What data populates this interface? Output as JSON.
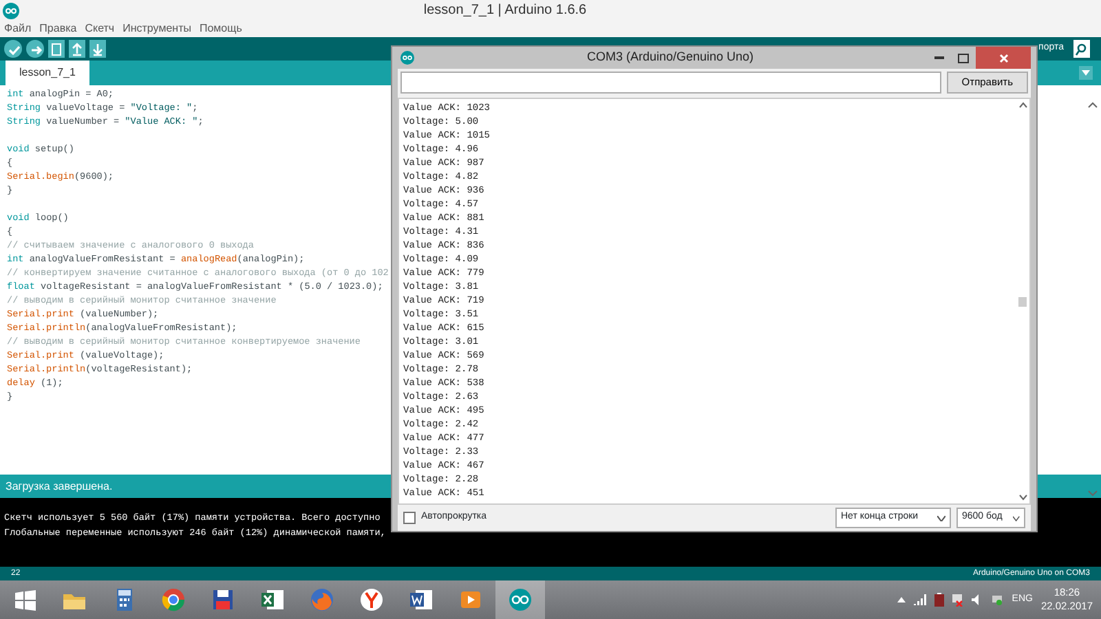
{
  "ide_window": {
    "title": "lesson_7_1 | Arduino 1.6.6",
    "menu": [
      "Файл",
      "Правка",
      "Скетч",
      "Инструменты",
      "Помощь"
    ],
    "toolbar": {
      "buttons": [
        {
          "kind": "verify"
        },
        {
          "kind": "upload"
        },
        {
          "kind": "new"
        },
        {
          "kind": "open"
        },
        {
          "kind": "save"
        }
      ],
      "serial_monitor_label": "порта"
    },
    "tabs": [
      {
        "label": "lesson_7_1",
        "selected": true
      }
    ],
    "code_lines": [
      {
        "kind": "code",
        "segments": [
          {
            "kind": "keyword",
            "text": "int"
          },
          {
            "kind": "plain",
            "text": " analogPin = A0;"
          }
        ]
      },
      {
        "kind": "code",
        "segments": [
          {
            "kind": "keyword",
            "text": "String"
          },
          {
            "kind": "plain",
            "text": " valueVoltage = "
          },
          {
            "kind": "string",
            "text": "\"Voltage: \""
          },
          {
            "kind": "plain",
            "text": ";"
          }
        ]
      },
      {
        "kind": "code",
        "segments": [
          {
            "kind": "keyword",
            "text": "String"
          },
          {
            "kind": "plain",
            "text": " valueNumber = "
          },
          {
            "kind": "string",
            "text": "\"Value ACK: \""
          },
          {
            "kind": "plain",
            "text": ";"
          }
        ]
      },
      {
        "kind": "blank"
      },
      {
        "kind": "code",
        "segments": [
          {
            "kind": "keyword",
            "text": "void"
          },
          {
            "kind": "plain",
            "text": " setup()"
          }
        ]
      },
      {
        "kind": "code",
        "segments": [
          {
            "kind": "plain",
            "text": "{"
          }
        ]
      },
      {
        "kind": "code",
        "segments": [
          {
            "kind": "function",
            "text": "Serial.begin"
          },
          {
            "kind": "plain",
            "text": "(9600);"
          }
        ]
      },
      {
        "kind": "code",
        "segments": [
          {
            "kind": "plain",
            "text": "}"
          }
        ]
      },
      {
        "kind": "blank"
      },
      {
        "kind": "code",
        "segments": [
          {
            "kind": "keyword",
            "text": "void"
          },
          {
            "kind": "plain",
            "text": " loop()"
          }
        ]
      },
      {
        "kind": "code",
        "segments": [
          {
            "kind": "plain",
            "text": "{"
          }
        ]
      },
      {
        "kind": "code",
        "segments": [
          {
            "kind": "comment",
            "text": "// считываем значение с аналогового 0 выхода"
          }
        ]
      },
      {
        "kind": "code",
        "segments": [
          {
            "kind": "keyword",
            "text": "int"
          },
          {
            "kind": "plain",
            "text": " analogValueFromResistant = "
          },
          {
            "kind": "function",
            "text": "analogRead"
          },
          {
            "kind": "plain",
            "text": "(analogPin);"
          }
        ]
      },
      {
        "kind": "code",
        "segments": [
          {
            "kind": "comment",
            "text": "// конвертируем значение считанное с аналогового выхода (от 0 до 102"
          }
        ]
      },
      {
        "kind": "code",
        "segments": [
          {
            "kind": "keyword",
            "text": "float"
          },
          {
            "kind": "plain",
            "text": " voltageResistant = analogValueFromResistant * (5.0 / 1023.0);"
          }
        ]
      },
      {
        "kind": "code",
        "segments": [
          {
            "kind": "comment",
            "text": "// выводим в серийный монитор считанное значение"
          }
        ]
      },
      {
        "kind": "code",
        "segments": [
          {
            "kind": "function",
            "text": "Serial.print"
          },
          {
            "kind": "plain",
            "text": " (valueNumber);"
          }
        ]
      },
      {
        "kind": "code",
        "segments": [
          {
            "kind": "function",
            "text": "Serial.println"
          },
          {
            "kind": "plain",
            "text": "(analogValueFromResistant);"
          }
        ]
      },
      {
        "kind": "code",
        "segments": [
          {
            "kind": "comment",
            "text": "// выводим в серийный монитор считанное конвертируемое значение"
          }
        ]
      },
      {
        "kind": "code",
        "segments": [
          {
            "kind": "function",
            "text": "Serial.print"
          },
          {
            "kind": "plain",
            "text": " (valueVoltage);"
          }
        ]
      },
      {
        "kind": "code",
        "segments": [
          {
            "kind": "function",
            "text": "Serial.println"
          },
          {
            "kind": "plain",
            "text": "(voltageResistant);"
          }
        ]
      },
      {
        "kind": "code",
        "segments": [
          {
            "kind": "function",
            "text": "delay"
          },
          {
            "kind": "plain",
            "text": " (1);"
          }
        ]
      },
      {
        "kind": "code",
        "segments": [
          {
            "kind": "plain",
            "text": "}"
          }
        ]
      }
    ],
    "status_message": "Загрузка завершена.",
    "console_lines": [
      "Скетч использует 5 560 байт (17%) памяти устройства. Всего доступно",
      "Глобальные переменные используют 246 байт (12%) динамической памяти,"
    ],
    "status_bar": {
      "line_number": "22",
      "board": "Arduino/Genuino Uno on COM3"
    }
  },
  "serial_monitor": {
    "title": "COM3 (Arduino/Genuino Uno)",
    "send_button": "Отправить",
    "output": [
      "Value ACK: 1023",
      "Voltage: 5.00",
      "Value ACK: 1015",
      "Voltage: 4.96",
      "Value ACK: 987",
      "Voltage: 4.82",
      "Value ACK: 936",
      "Voltage: 4.57",
      "Value ACK: 881",
      "Voltage: 4.31",
      "Value ACK: 836",
      "Voltage: 4.09",
      "Value ACK: 779",
      "Voltage: 3.81",
      "Value ACK: 719",
      "Voltage: 3.51",
      "Value ACK: 615",
      "Voltage: 3.01",
      "Value ACK: 569",
      "Voltage: 2.78",
      "Value ACK: 538",
      "Voltage: 2.63",
      "Value ACK: 495",
      "Voltage: 2.42",
      "Value ACK: 477",
      "Voltage: 2.33",
      "Value ACK: 467",
      "Voltage: 2.28",
      "Value ACK: 451"
    ],
    "autoscroll": {
      "label": "Автопрокрутка",
      "checked": false
    },
    "line_ending": "Нет конца строки",
    "baud_rate": "9600 бод"
  },
  "taskbar": {
    "apps": [
      {
        "kind": "start",
        "active": false
      },
      {
        "kind": "folder",
        "active": false
      },
      {
        "kind": "calculator",
        "active": false
      },
      {
        "kind": "browser-circle",
        "active": false
      },
      {
        "kind": "floppy",
        "active": false
      },
      {
        "kind": "spreadsheet",
        "active": false
      },
      {
        "kind": "fox-browser",
        "active": false
      },
      {
        "kind": "y-browser",
        "active": false
      },
      {
        "kind": "document",
        "active": false
      },
      {
        "kind": "player",
        "active": false
      },
      {
        "kind": "infinity",
        "active": true
      }
    ],
    "tray": {
      "language": "ENG",
      "time": "18:26",
      "date": "22.02.2017"
    }
  }
}
